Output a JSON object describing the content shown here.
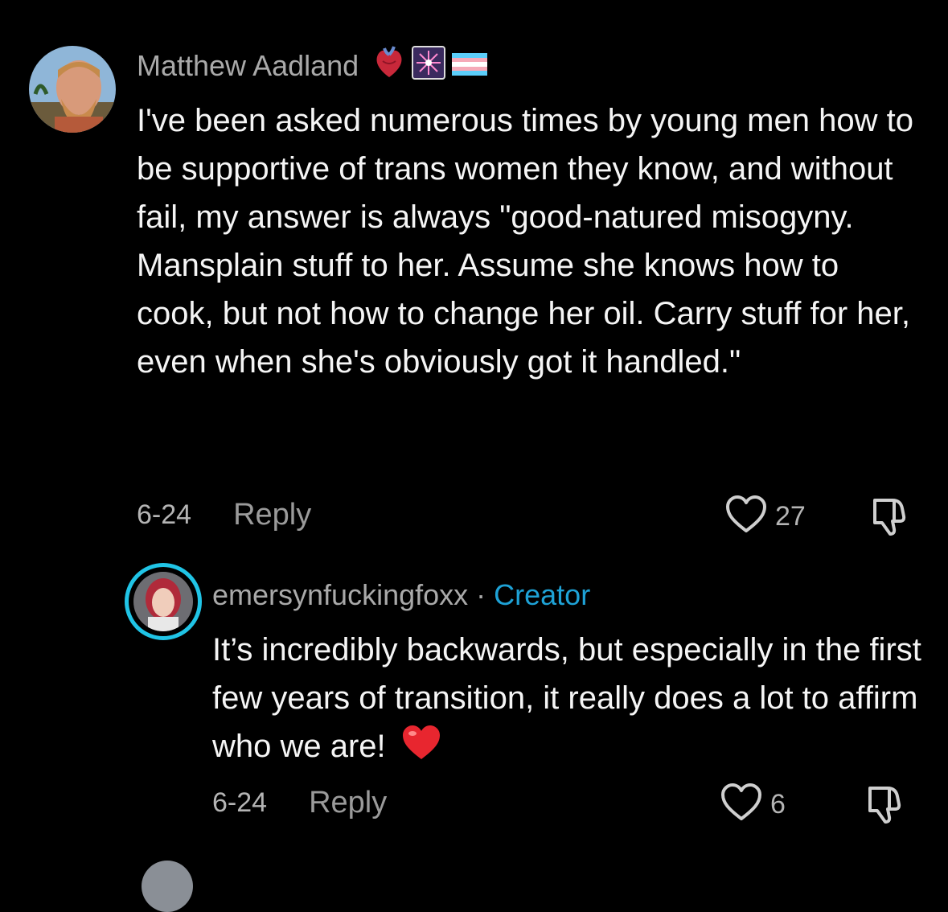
{
  "comments": [
    {
      "author": "Matthew Aadland",
      "badges": [
        "anatomical-heart-icon",
        "fireworks-icon",
        "transgender-flag-icon"
      ],
      "text": "I've been asked numerous times by young men how to be supportive of trans women they know, and without fail, my answer is always \"good-natured misogyny. Mansplain stuff to her. Assume she knows how to cook, but not how to change her oil. Carry stuff for her, even when she's obviously got it handled.\"",
      "date": "6-24",
      "reply_label": "Reply",
      "like_count": "27"
    }
  ],
  "replies": [
    {
      "author": "emersynfuckingfoxx",
      "separator": "·",
      "creator_label": "Creator",
      "text": "It’s incredibly backwards, but especially in the first few years of transition, it really does a lot to affirm who we are!",
      "emoji": "red-heart-icon",
      "date": "6-24",
      "reply_label": "Reply",
      "like_count": "6"
    }
  ],
  "colors": {
    "background": "#000000",
    "creator_accent": "#1ea2d6",
    "meta_text": "#a9a9a9"
  }
}
